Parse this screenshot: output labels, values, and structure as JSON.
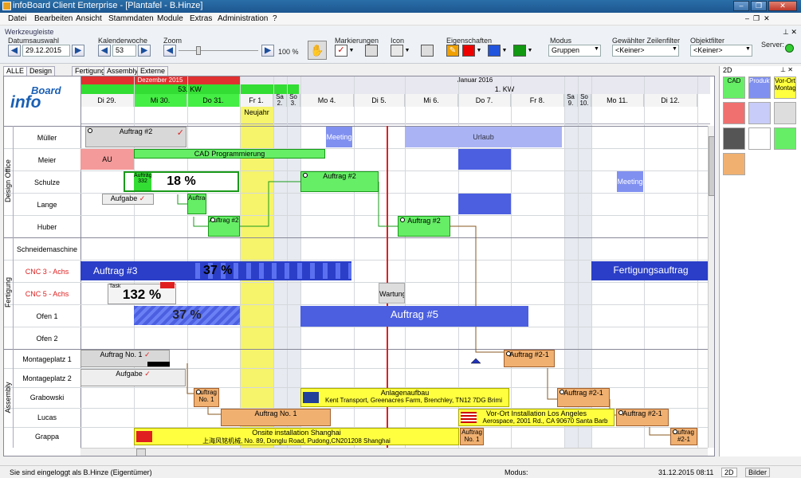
{
  "window": {
    "title": "infoBoard Client Enterprise - [Plantafel - B.Hinze]"
  },
  "menu": [
    "Datei",
    "Bearbeiten",
    "Ansicht",
    "Stammdaten",
    "Module",
    "Extras",
    "Administration",
    "?"
  ],
  "toolbar": {
    "title": "Werkzeugleiste",
    "date_label": "Datumsauswahl",
    "date_value": "29.12.2015",
    "week_label": "Kalenderwoche",
    "week_value": "53",
    "zoom_label": "Zoom",
    "zoom_value": "100 %",
    "markers_label": "Markierungen",
    "icon_label": "Icon",
    "props_label": "Eigenschaften",
    "mode_label": "Modus",
    "mode_value": "Gruppen",
    "rowfilter_label": "Gewählter Zeilenfilter",
    "rowfilter_value": "<Keiner>",
    "objfilter_label": "Objektfilter",
    "objfilter_value": "<Keiner>",
    "server_label": "Server:"
  },
  "tabs": [
    "ALLE",
    "Design Office",
    "Fertigung",
    "Assembly",
    "Externe"
  ],
  "header": {
    "month1": "Dezember 2015",
    "month2": "Januar 2016",
    "week1": "53. KW",
    "week2": "1. KW",
    "days": [
      "Di 29.",
      "Mi 30.",
      "Do 31.",
      "Fr 1.",
      "Sa 2.",
      "So 3.",
      "Mo 4.",
      "Di 5.",
      "Mi 6.",
      "Do 7.",
      "Fr 8.",
      "Sa 9.",
      "So 10.",
      "Mo 11.",
      "Di 12."
    ],
    "holiday": "Neujahr"
  },
  "groups": [
    "Design Office",
    "Fertigung",
    "Assembly"
  ],
  "rows": [
    "Müller",
    "Meier",
    "Schulze",
    "Lange",
    "Huber",
    "Schneidemaschine",
    "CNC 3 - Achs",
    "CNC 5 - Achs",
    "Ofen 1",
    "Ofen 2",
    "Montageplatz 1",
    "Montageplatz 2",
    "Grabowski",
    "Lucas",
    "Grappa"
  ],
  "bars": {
    "b1": "Auftrag #2",
    "b2": "Meeting",
    "b3": "Urlaub",
    "b4": "AU",
    "b5": "CAD Programmierung",
    "b6": "18 %",
    "b6s": "Aufträge 332",
    "b7": "Auftrag #2",
    "b8": "Meeting",
    "b9": "Aufgabe",
    "b10": "Auftrag",
    "b11": "Auftrag #2",
    "b12": "Auftrag #2",
    "b13": "Auftrag  #3",
    "b14": "37 %",
    "b15": "Fertigungsauftrag",
    "b16": "132 %",
    "b16s": "Task",
    "b17": "Wartung",
    "b18": "37 %",
    "b19": "Auftrag  #5",
    "b20": "Auftrag No. 1",
    "b21": "Auftrag #2-1",
    "b22": "Aufgabe",
    "b23": "Auftrag No. 1",
    "b24": "Anlagenaufbau",
    "b24b": "Kent Transport, Greenacres Farm, Brenchley, TN12 7DG Brimi",
    "b25": "Auftrag #2-1",
    "b26": "Auftrag No. 1",
    "b27": "Vor-Ort Installation Los Angeles",
    "b27b": "Aerospace, 2001 Rd., CA 90670 Santa Barb",
    "b28": "Auftrag #2-1",
    "b29": "Onsite installation Shanghai",
    "b29b": "上海风铭机械, No. 89, Donglu Road, Pudong,CN201208 Shanghai",
    "b30": "Auftrag No. 1",
    "b31": "Auftrag #2-1"
  },
  "right_panel": {
    "title": "2D",
    "col1": "CAD",
    "col2": "Produktion",
    "col3": "Vor-Ort Montage"
  },
  "status": {
    "left": "Sie sind eingeloggt als B.Hinze (Eigentümer)",
    "mode": "Modus:",
    "datetime": "31.12.2015 08:11",
    "tab2d": "2D",
    "tabbilder": "Bilder"
  }
}
